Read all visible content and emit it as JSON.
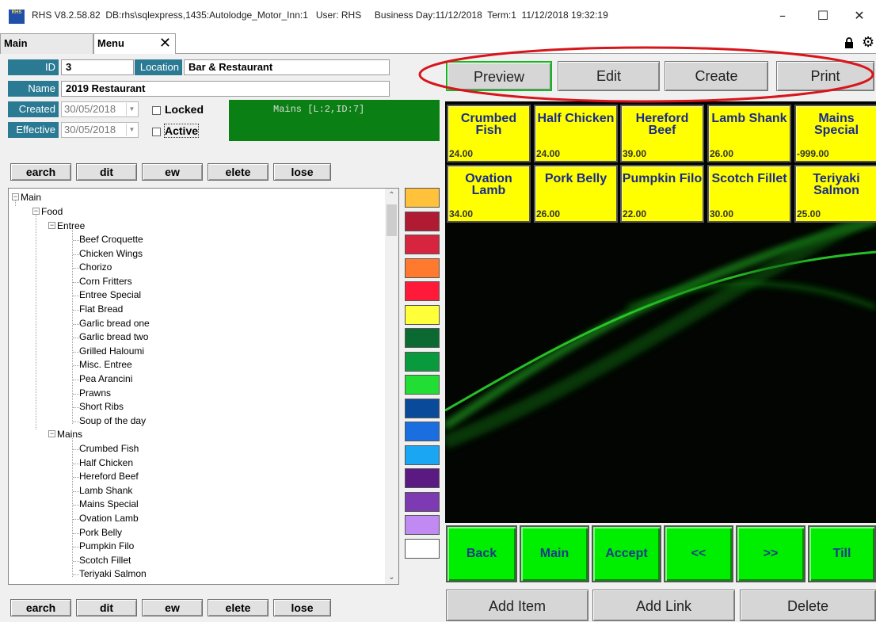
{
  "window": {
    "title": "RHS V8.2.58.82  DB:rhs\\sqlexpress,1435:Autolodge_Motor_Inn:1   User: RHS     Business Day:11/12/2018  Term:1  11/12/2018 19:32:19",
    "logo_text": "RHS",
    "minimize": "–",
    "maximize": "☐",
    "close": "✕"
  },
  "tabs": [
    {
      "label": "Main"
    },
    {
      "label": "Menu",
      "close": "✕"
    }
  ],
  "form": {
    "id_label": "ID",
    "id_value": "3",
    "location_label": "Location",
    "location_value": "Bar & Restaurant",
    "name_label": "Name",
    "name_value": "2019 Restaurant",
    "created_label": "Created",
    "created_value": "30/05/2018",
    "effective_label": "Effective",
    "effective_value": "30/05/2018",
    "locked_label": "Locked",
    "active_label": "Active",
    "status_text": "Mains [L:2,ID:7]"
  },
  "list_buttons": {
    "search": "earch",
    "edit": "dit",
    "new": "ew",
    "delete": "elete",
    "close": "lose"
  },
  "tree": {
    "root": "Main",
    "food": "Food",
    "entree": "Entree",
    "entree_items": [
      "Beef Croquette",
      "Chicken Wings",
      "Chorizo",
      "Corn Fritters",
      "Entree Special",
      "Flat Bread",
      "Garlic bread one",
      "Garlic bread two",
      "Grilled Haloumi",
      "Misc. Entree",
      "Pea Arancini",
      "Prawns",
      "Short Ribs",
      "Soup of the day"
    ],
    "mains": "Mains",
    "mains_items": [
      "Crumbed Fish",
      "Half Chicken",
      "Hereford Beef",
      "Lamb Shank",
      "Mains Special",
      "Ovation Lamb",
      "Pork Belly",
      "Pumpkin Filo",
      "Scotch Fillet",
      "Teriyaki Salmon"
    ]
  },
  "swatches": [
    "#ffc23a",
    "#b11a33",
    "#d8253f",
    "#ff7a2e",
    "#ff1a3a",
    "#ffff3a",
    "#0a6a32",
    "#0a9a3e",
    "#22dd33",
    "#0a4a9a",
    "#1a6ee0",
    "#1aa6f2",
    "#5a1a82",
    "#7e3ab2",
    "#c08af2",
    "#ffffff"
  ],
  "top_buttons": {
    "preview": "Preview",
    "edit": "Edit",
    "create": "Create",
    "print": "Print"
  },
  "menu_items": [
    {
      "name": "Crumbed Fish",
      "price": "24.00"
    },
    {
      "name": "Half Chicken",
      "price": "24.00"
    },
    {
      "name": "Hereford Beef",
      "price": "39.00"
    },
    {
      "name": "Lamb Shank",
      "price": "26.00"
    },
    {
      "name": "Mains Special",
      "price": "-999.00"
    },
    {
      "name": "Ovation Lamb",
      "price": "34.00"
    },
    {
      "name": "Pork Belly",
      "price": "26.00"
    },
    {
      "name": "Pumpkin Filo",
      "price": "22.00"
    },
    {
      "name": "Scotch Fillet",
      "price": "30.00"
    },
    {
      "name": "Teriyaki Salmon",
      "price": "25.00"
    }
  ],
  "nav_buttons": {
    "back": "Back",
    "main": "Main",
    "accept": "Accept",
    "prev": "<<",
    "next": ">>",
    "till": "Till"
  },
  "bottom_buttons": {
    "add_item": "Add Item",
    "add_link": "Add Link",
    "delete": "Delete"
  }
}
